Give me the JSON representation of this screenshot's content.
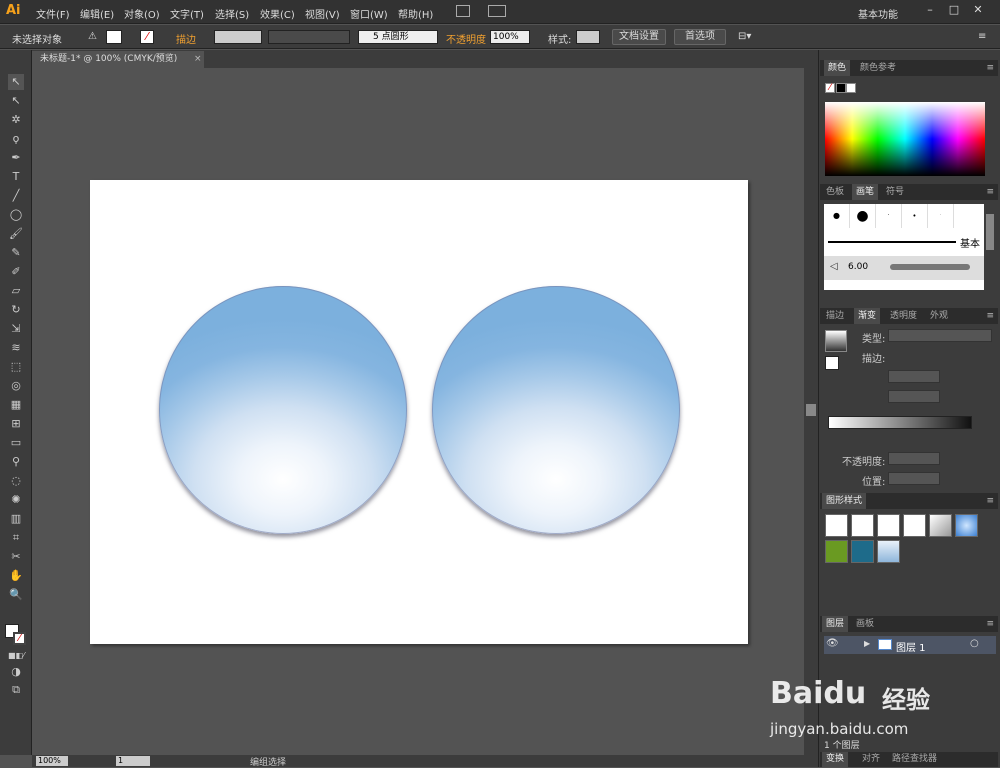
{
  "app": {
    "logo": "Ai",
    "workspace": "基本功能"
  },
  "menu": [
    "文件(F)",
    "编辑(E)",
    "对象(O)",
    "文字(T)",
    "选择(S)",
    "效果(C)",
    "视图(V)",
    "窗口(W)",
    "帮助(H)"
  ],
  "controlbar": {
    "selection": "未选择对象",
    "stroke_label": "描边",
    "brush_size": "5 点圆形",
    "opacity_label": "不透明度",
    "opacity_value": "100%",
    "style_label": "样式:",
    "doc_setup": "文档设置",
    "preferences": "首选项"
  },
  "document": {
    "tab_title": "未标题-1* @ 100% (CMYK/预览)"
  },
  "panels": {
    "color_tabs": [
      "颜色",
      "颜色参考"
    ],
    "brush_tabs": [
      "色板",
      "画笔",
      "符号"
    ],
    "brush_basic": "基本",
    "brush_size": "6.00",
    "gradient_tabs": [
      "描边",
      "渐变",
      "透明度",
      "外观"
    ],
    "gradient": {
      "type_label": "类型:",
      "stroke_label": "描边:",
      "opacity_label": "不透明度:",
      "position_label": "位置:"
    },
    "graphic_styles_title": "图形样式",
    "layer_tabs": [
      "图层",
      "画板"
    ],
    "layer_name": "图层 1",
    "layer_count": "1 个图层",
    "bottom_tabs": [
      "变换",
      "对齐",
      "路径查找器"
    ]
  },
  "status": {
    "zoom": "100%",
    "page": "1",
    "mode": "编组选择"
  },
  "watermark": {
    "brand": "Baidu",
    "brand_cn": "经验",
    "url": "jingyan.baidu.com"
  },
  "colors": {
    "accent": "#f7a21b",
    "sphere_edge": "#7cb0dd",
    "sphere_center": "#ffffff"
  }
}
